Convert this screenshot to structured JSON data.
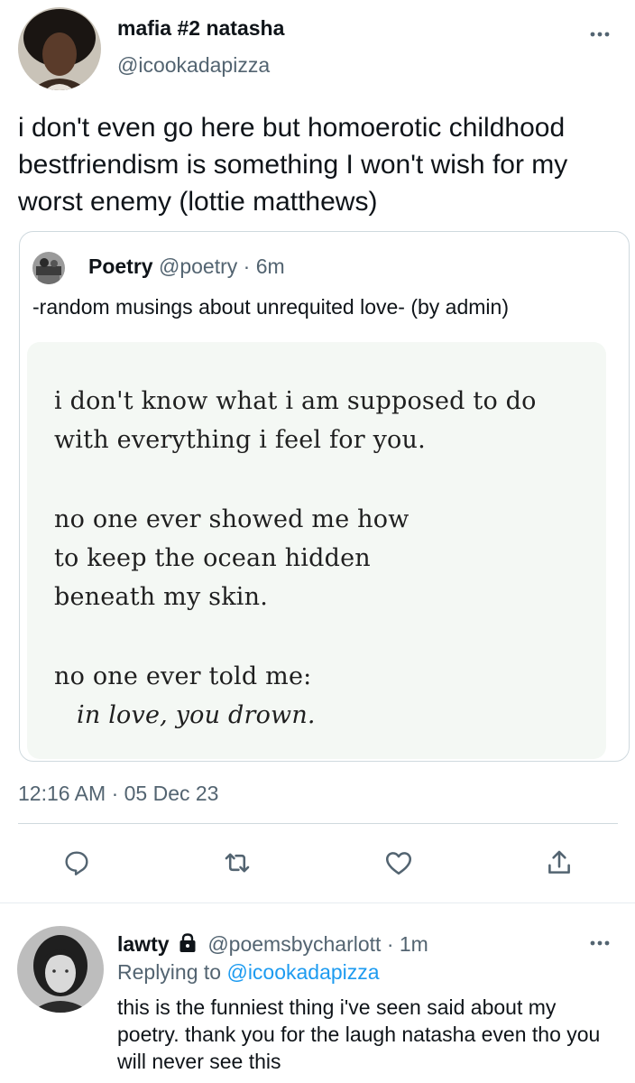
{
  "main_tweet": {
    "display_name": "mafia #2 natasha",
    "handle": "@icookadapizza",
    "text": "i don't even go here but homoerotic childhood bestfriendism is something I won't wish for my worst enemy (lottie matthews)",
    "timestamp": "12:16 AM · 05 Dec 23"
  },
  "quote": {
    "display_name": "Poetry",
    "handle": "@poetry",
    "separator": "·",
    "time": "6m",
    "text": "-random musings about unrequited love- (by admin)",
    "poem_lines": [
      "i don't know what i am supposed to do",
      "with everything i feel for you.",
      "no one ever showed me how",
      "to keep the ocean hidden",
      "beneath my skin.",
      "no one ever told me:",
      "in love, you drown."
    ]
  },
  "actions": [
    {
      "icon": "reply-icon"
    },
    {
      "icon": "retweet-icon"
    },
    {
      "icon": "like-icon"
    },
    {
      "icon": "share-icon"
    }
  ],
  "reply": {
    "display_name": "lawty",
    "handle": "@poemsbycharlott",
    "separator": "·",
    "time": "1m",
    "replying_to_label": "Replying to",
    "replying_to_handle": "@icookadapizza",
    "text": "this is the funniest thing i've seen said about my poetry. thank you for the laugh natasha even tho you will never see this"
  },
  "colors": {
    "text_primary": "#0f1419",
    "text_secondary": "#536471",
    "link": "#1d9bf0",
    "border": "#cfd9de",
    "poem_background": "#f4f8f4"
  }
}
